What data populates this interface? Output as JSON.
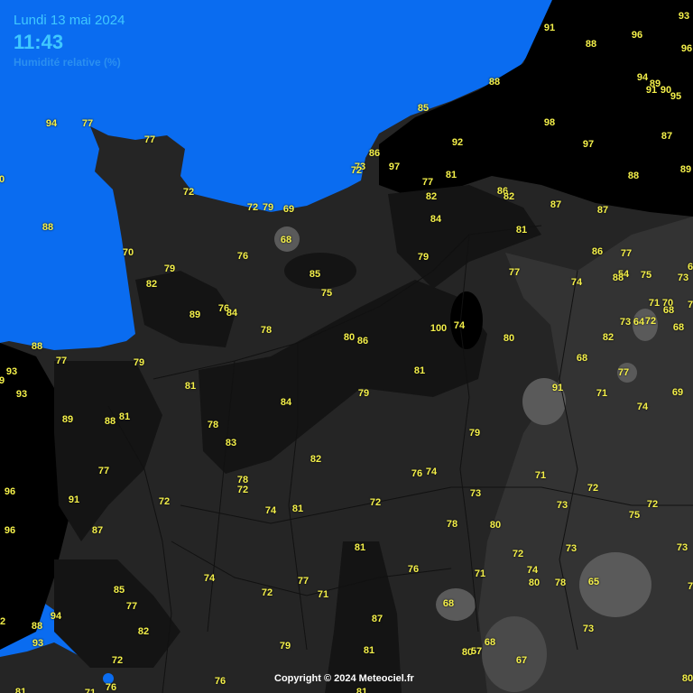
{
  "header": {
    "date": "Lundi 13 mai 2024",
    "time": "11:43",
    "variable": "Humidité relative (%)"
  },
  "copyright": "Copyright © 2024 Meteociel.fr",
  "colors": {
    "sea": "#0a6cf0",
    "title": "#3fc8ff",
    "value": "#f4f04a"
  },
  "values": [
    "91",
    "88",
    "96",
    "93",
    "96",
    "94",
    "89",
    "90",
    "91",
    "95",
    "88",
    "85",
    "98",
    "97",
    "87",
    "92",
    "86",
    "73",
    "72",
    "97",
    "81",
    "77",
    "82",
    "88",
    "89",
    "86",
    "82",
    "87",
    "87",
    "84",
    "81",
    "86",
    "77",
    "54",
    "88",
    "75",
    "73",
    "6",
    "71",
    "70",
    "68",
    "7",
    "64",
    "72",
    "73",
    "68",
    "94",
    "77",
    "77",
    "72",
    "72",
    "79",
    "69",
    "88",
    "76",
    "68",
    "85",
    "75",
    "70",
    "79",
    "82",
    "89",
    "76",
    "84",
    "78",
    "80",
    "86",
    "81",
    "79",
    "77",
    "74",
    "100",
    "74",
    "80",
    "82",
    "68",
    "77",
    "71",
    "74",
    "69",
    "91",
    "88",
    "77",
    "79",
    "81",
    "84",
    "79",
    "93",
    "9",
    "93",
    "89",
    "88",
    "81",
    "78",
    "83",
    "79",
    "77",
    "82",
    "78",
    "76",
    "74",
    "71",
    "72",
    "73",
    "72",
    "75",
    "72",
    "96",
    "91",
    "72",
    "74",
    "81",
    "72",
    "78",
    "80",
    "73",
    "96",
    "87",
    "81",
    "76",
    "72",
    "74",
    "80",
    "78",
    "65",
    "73",
    "73",
    "77",
    "71",
    "68",
    "85",
    "74",
    "77",
    "72",
    "71",
    "7",
    "94",
    "82",
    "88",
    "93",
    "72",
    "79",
    "87",
    "81",
    "73",
    "80",
    "57",
    "68",
    "67",
    "76",
    "76",
    "81",
    "81",
    "71",
    "2",
    "0",
    "80"
  ]
}
